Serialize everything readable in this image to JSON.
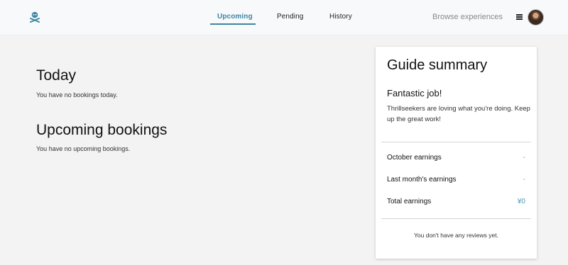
{
  "nav": {
    "tabs": [
      {
        "label": "Upcoming",
        "active": true
      },
      {
        "label": "Pending",
        "active": false
      },
      {
        "label": "History",
        "active": false
      }
    ],
    "browse_label": "Browse experiences",
    "logo_icon": "skull-crossbones-icon",
    "menu_icon": "hamburger-menu-icon",
    "accent_color": "#3d86a3"
  },
  "main": {
    "today_title": "Today",
    "today_text": "You have no bookings today.",
    "upcoming_title": "Upcoming bookings",
    "upcoming_text": "You have no upcoming bookings."
  },
  "summary": {
    "title": "Guide summary",
    "subtitle": "Fantastic job!",
    "message": "Thrillseekers are loving what you're doing. Keep up the great work!",
    "rows": [
      {
        "label": "October earnings",
        "value": "-"
      },
      {
        "label": "Last month's earnings",
        "value": "-"
      },
      {
        "label": "Total earnings",
        "value": "¥0"
      }
    ],
    "reviews_text": "You don't have any reviews yet."
  }
}
